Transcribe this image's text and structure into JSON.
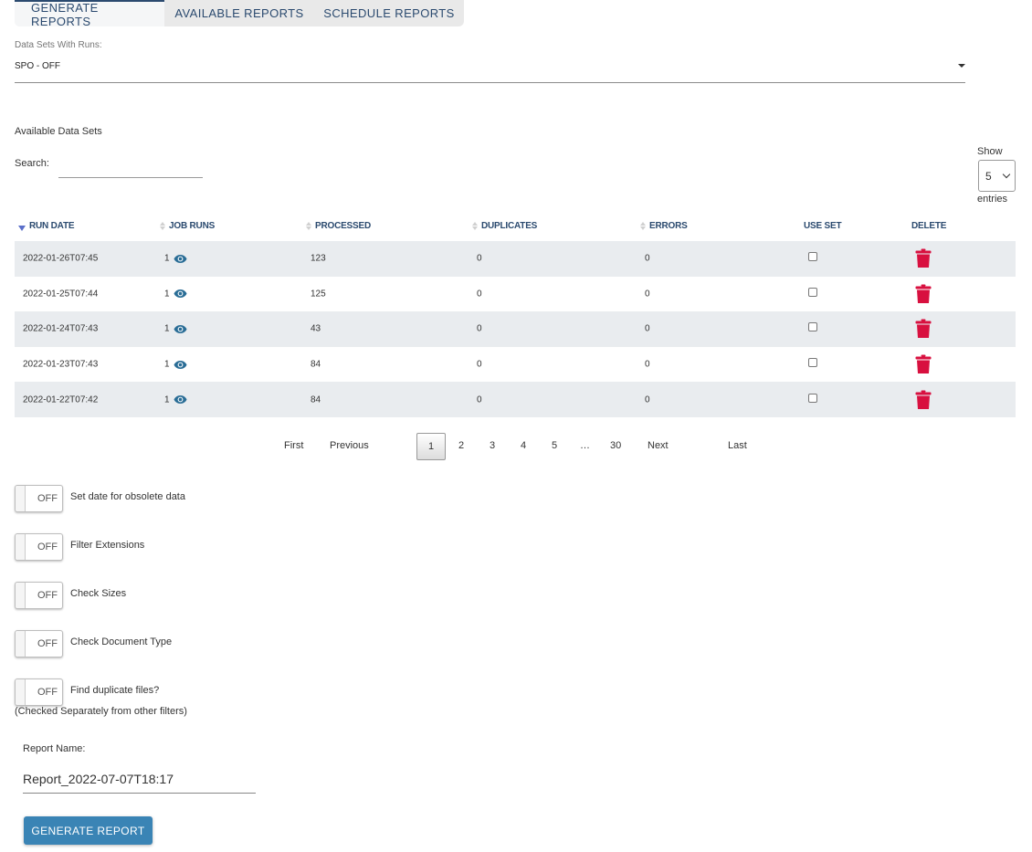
{
  "tabs": [
    {
      "label": "GENERATE REPORTS",
      "active": true
    },
    {
      "label": "AVAILABLE REPORTS",
      "active": false
    },
    {
      "label": "SCHEDULE REPORTS",
      "active": false
    }
  ],
  "dataset_select": {
    "label": "Data Sets With Runs:",
    "value": "SPO - OFF"
  },
  "available_title": "Available Data Sets",
  "search": {
    "label": "Search:",
    "value": ""
  },
  "page_length": {
    "show_label": "Show",
    "value": "5",
    "entries_label": "entries"
  },
  "table": {
    "columns": [
      {
        "label": "RUN DATE",
        "sort": "desc"
      },
      {
        "label": "JOB RUNS",
        "sort": "none"
      },
      {
        "label": "PROCESSED",
        "sort": "none"
      },
      {
        "label": "DUPLICATES",
        "sort": "none"
      },
      {
        "label": "ERRORS",
        "sort": "none"
      },
      {
        "label": "USE SET",
        "sort": null
      },
      {
        "label": "DELETE",
        "sort": null
      }
    ],
    "rows": [
      {
        "run_date": "2022-01-26T07:45",
        "job_runs": "1",
        "processed": "123",
        "duplicates": "0",
        "errors": "0",
        "use_set": false
      },
      {
        "run_date": "2022-01-25T07:44",
        "job_runs": "1",
        "processed": "125",
        "duplicates": "0",
        "errors": "0",
        "use_set": false
      },
      {
        "run_date": "2022-01-24T07:43",
        "job_runs": "1",
        "processed": "43",
        "duplicates": "0",
        "errors": "0",
        "use_set": false
      },
      {
        "run_date": "2022-01-23T07:43",
        "job_runs": "1",
        "processed": "84",
        "duplicates": "0",
        "errors": "0",
        "use_set": false
      },
      {
        "run_date": "2022-01-22T07:42",
        "job_runs": "1",
        "processed": "84",
        "duplicates": "0",
        "errors": "0",
        "use_set": false
      }
    ]
  },
  "pagination": {
    "first": "First",
    "previous": "Previous",
    "pages": [
      "1",
      "2",
      "3",
      "4",
      "5",
      "…",
      "30"
    ],
    "current": "1",
    "next": "Next",
    "last": "Last"
  },
  "toggles": [
    {
      "label": "Set date for obsolete data",
      "state": "OFF"
    },
    {
      "label": "Filter Extensions",
      "state": "OFF"
    },
    {
      "label": "Check Sizes",
      "state": "OFF"
    },
    {
      "label": "Check Document Type",
      "state": "OFF"
    },
    {
      "label": "Find duplicate files?",
      "state": "OFF"
    }
  ],
  "duplicate_note": "(Checked Separately from other filters)",
  "report_name": {
    "label": "Report Name:",
    "value": "Report_2022-07-07T18:17"
  },
  "generate_button": "GENERATE REPORT",
  "colors": {
    "header_text": "#2b4a6f",
    "icon_blue": "#2a6d96",
    "delete_red": "#d8103f",
    "button_blue": "#3a84b5",
    "row_stripe": "#e9ecef"
  }
}
